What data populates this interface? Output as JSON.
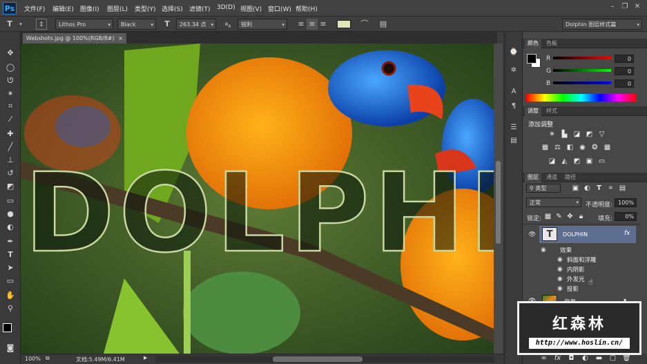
{
  "app": {
    "logo": "Ps"
  },
  "menu": [
    "文件(F)",
    "编辑(E)",
    "图像(I)",
    "图层(L)",
    "类型(Y)",
    "选择(S)",
    "滤镜(T)",
    "3D(D)",
    "视图(V)",
    "窗口(W)",
    "帮助(H)"
  ],
  "window_controls": {
    "minimize": "–",
    "restore": "❐",
    "close": "✕"
  },
  "options": {
    "tool_icon": "T",
    "font_family": "Lithos Pro",
    "font_style": "Black",
    "font_size": "263.34 点",
    "aa_label": "a",
    "aa_sub": "a",
    "antialias": "锐利",
    "text_color": "#dfe8b8",
    "workspace": "Dolphin 图层样式篇"
  },
  "document": {
    "tab_title": "Webshots.jpg @ 100%(RGB/8#)",
    "close_glyph": "×",
    "text_overlay": "DOLPHI",
    "zoom": "100%",
    "doc_info": "文档:5.49M/6.41M"
  },
  "tools": [
    "move-tool",
    "marquee-tool",
    "lasso-tool",
    "magic-wand-tool",
    "crop-tool",
    "eyedropper-tool",
    "healing-brush-tool",
    "brush-tool",
    "clone-stamp-tool",
    "history-brush-tool",
    "eraser-tool",
    "gradient-tool",
    "blur-tool",
    "dodge-tool",
    "pen-tool",
    "type-tool",
    "path-selection-tool",
    "shape-tool",
    "hand-tool",
    "zoom-tool"
  ],
  "color_panel": {
    "tabs": [
      "颜色",
      "色板"
    ],
    "channels": [
      {
        "label": "R",
        "value": "0"
      },
      {
        "label": "G",
        "value": "0"
      },
      {
        "label": "B",
        "value": "0"
      }
    ]
  },
  "adjustments_panel": {
    "tabs": [
      "调整",
      "样式"
    ],
    "title": "添加调整"
  },
  "layers_panel": {
    "tabs": [
      "图层",
      "通道",
      "路径"
    ],
    "filter_kind": "类型",
    "blend_mode": "正常",
    "opacity_label": "不透明度:",
    "opacity": "100%",
    "lock_label": "锁定:",
    "fill_label": "填充:",
    "fill": "0%",
    "text_layer": {
      "name": "DOLPHIN",
      "thumb": "T",
      "fx": "fx"
    },
    "effects_label": "效果",
    "effects": [
      "斜面和浮雕",
      "内阴影",
      "外发光",
      "投影"
    ],
    "bg_layer": {
      "name": "背景"
    }
  },
  "watermark": {
    "title": "红森林",
    "url": "http://www.hoslin.cn/"
  },
  "colors": {
    "accent_blue": "#5b6d9a",
    "selected_layer": "#5f6f92"
  }
}
